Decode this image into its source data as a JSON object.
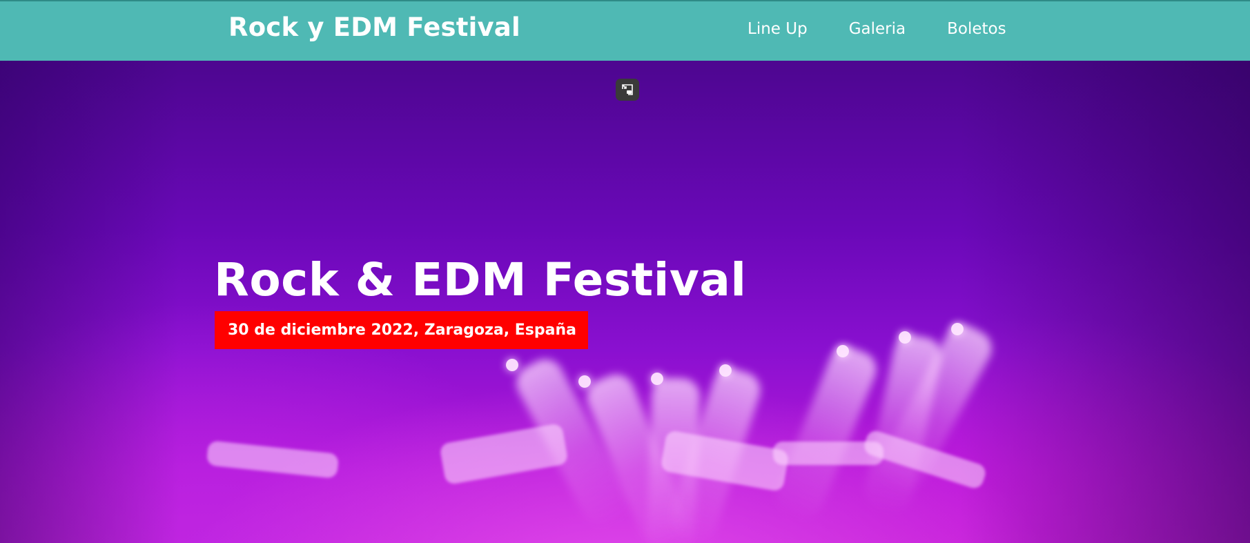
{
  "header": {
    "logo": "Rock y EDM Festival",
    "nav": [
      {
        "label": "Line Up"
      },
      {
        "label": "Galeria"
      },
      {
        "label": "Boletos"
      }
    ],
    "background_color": "#4fb9b4"
  },
  "hero": {
    "title": "Rock & EDM Festival",
    "date_location": "30 de diciembre 2022, Zaragoza, España",
    "badge_color": "#ff0000",
    "pip_icon": "picture-in-picture-icon"
  }
}
